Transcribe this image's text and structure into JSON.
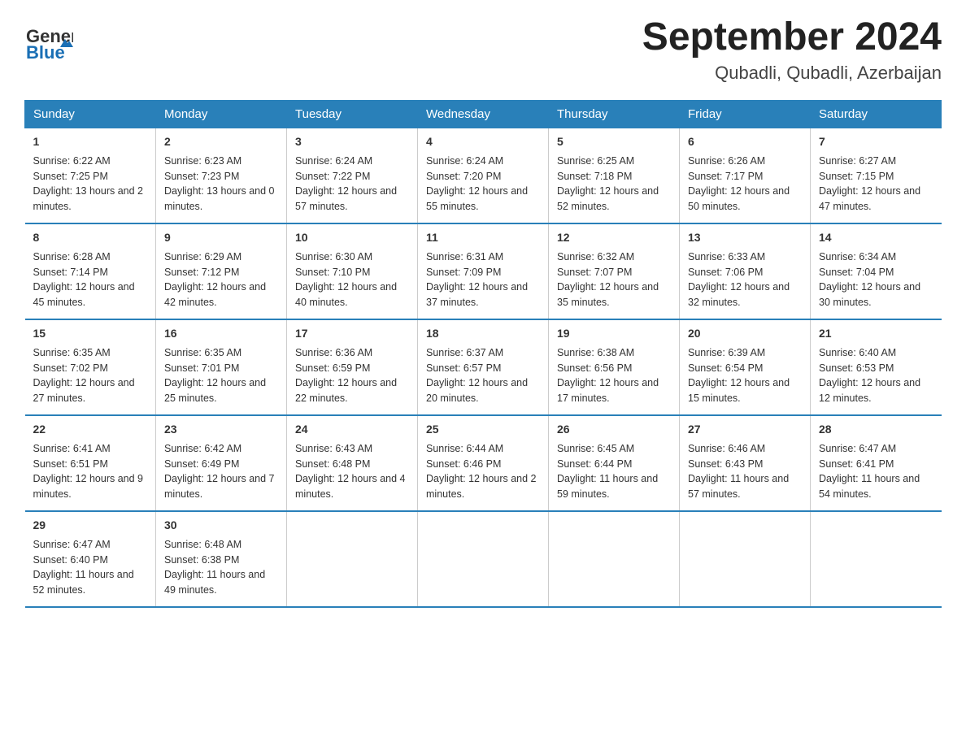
{
  "header": {
    "logo_general": "General",
    "logo_blue": "Blue",
    "month_year": "September 2024",
    "location": "Qubadli, Qubadli, Azerbaijan"
  },
  "weekdays": [
    "Sunday",
    "Monday",
    "Tuesday",
    "Wednesday",
    "Thursday",
    "Friday",
    "Saturday"
  ],
  "weeks": [
    [
      {
        "day": "1",
        "sunrise": "6:22 AM",
        "sunset": "7:25 PM",
        "daylight": "13 hours and 2 minutes."
      },
      {
        "day": "2",
        "sunrise": "6:23 AM",
        "sunset": "7:23 PM",
        "daylight": "13 hours and 0 minutes."
      },
      {
        "day": "3",
        "sunrise": "6:24 AM",
        "sunset": "7:22 PM",
        "daylight": "12 hours and 57 minutes."
      },
      {
        "day": "4",
        "sunrise": "6:24 AM",
        "sunset": "7:20 PM",
        "daylight": "12 hours and 55 minutes."
      },
      {
        "day": "5",
        "sunrise": "6:25 AM",
        "sunset": "7:18 PM",
        "daylight": "12 hours and 52 minutes."
      },
      {
        "day": "6",
        "sunrise": "6:26 AM",
        "sunset": "7:17 PM",
        "daylight": "12 hours and 50 minutes."
      },
      {
        "day": "7",
        "sunrise": "6:27 AM",
        "sunset": "7:15 PM",
        "daylight": "12 hours and 47 minutes."
      }
    ],
    [
      {
        "day": "8",
        "sunrise": "6:28 AM",
        "sunset": "7:14 PM",
        "daylight": "12 hours and 45 minutes."
      },
      {
        "day": "9",
        "sunrise": "6:29 AM",
        "sunset": "7:12 PM",
        "daylight": "12 hours and 42 minutes."
      },
      {
        "day": "10",
        "sunrise": "6:30 AM",
        "sunset": "7:10 PM",
        "daylight": "12 hours and 40 minutes."
      },
      {
        "day": "11",
        "sunrise": "6:31 AM",
        "sunset": "7:09 PM",
        "daylight": "12 hours and 37 minutes."
      },
      {
        "day": "12",
        "sunrise": "6:32 AM",
        "sunset": "7:07 PM",
        "daylight": "12 hours and 35 minutes."
      },
      {
        "day": "13",
        "sunrise": "6:33 AM",
        "sunset": "7:06 PM",
        "daylight": "12 hours and 32 minutes."
      },
      {
        "day": "14",
        "sunrise": "6:34 AM",
        "sunset": "7:04 PM",
        "daylight": "12 hours and 30 minutes."
      }
    ],
    [
      {
        "day": "15",
        "sunrise": "6:35 AM",
        "sunset": "7:02 PM",
        "daylight": "12 hours and 27 minutes."
      },
      {
        "day": "16",
        "sunrise": "6:35 AM",
        "sunset": "7:01 PM",
        "daylight": "12 hours and 25 minutes."
      },
      {
        "day": "17",
        "sunrise": "6:36 AM",
        "sunset": "6:59 PM",
        "daylight": "12 hours and 22 minutes."
      },
      {
        "day": "18",
        "sunrise": "6:37 AM",
        "sunset": "6:57 PM",
        "daylight": "12 hours and 20 minutes."
      },
      {
        "day": "19",
        "sunrise": "6:38 AM",
        "sunset": "6:56 PM",
        "daylight": "12 hours and 17 minutes."
      },
      {
        "day": "20",
        "sunrise": "6:39 AM",
        "sunset": "6:54 PM",
        "daylight": "12 hours and 15 minutes."
      },
      {
        "day": "21",
        "sunrise": "6:40 AM",
        "sunset": "6:53 PM",
        "daylight": "12 hours and 12 minutes."
      }
    ],
    [
      {
        "day": "22",
        "sunrise": "6:41 AM",
        "sunset": "6:51 PM",
        "daylight": "12 hours and 9 minutes."
      },
      {
        "day": "23",
        "sunrise": "6:42 AM",
        "sunset": "6:49 PM",
        "daylight": "12 hours and 7 minutes."
      },
      {
        "day": "24",
        "sunrise": "6:43 AM",
        "sunset": "6:48 PM",
        "daylight": "12 hours and 4 minutes."
      },
      {
        "day": "25",
        "sunrise": "6:44 AM",
        "sunset": "6:46 PM",
        "daylight": "12 hours and 2 minutes."
      },
      {
        "day": "26",
        "sunrise": "6:45 AM",
        "sunset": "6:44 PM",
        "daylight": "11 hours and 59 minutes."
      },
      {
        "day": "27",
        "sunrise": "6:46 AM",
        "sunset": "6:43 PM",
        "daylight": "11 hours and 57 minutes."
      },
      {
        "day": "28",
        "sunrise": "6:47 AM",
        "sunset": "6:41 PM",
        "daylight": "11 hours and 54 minutes."
      }
    ],
    [
      {
        "day": "29",
        "sunrise": "6:47 AM",
        "sunset": "6:40 PM",
        "daylight": "11 hours and 52 minutes."
      },
      {
        "day": "30",
        "sunrise": "6:48 AM",
        "sunset": "6:38 PM",
        "daylight": "11 hours and 49 minutes."
      },
      null,
      null,
      null,
      null,
      null
    ]
  ]
}
